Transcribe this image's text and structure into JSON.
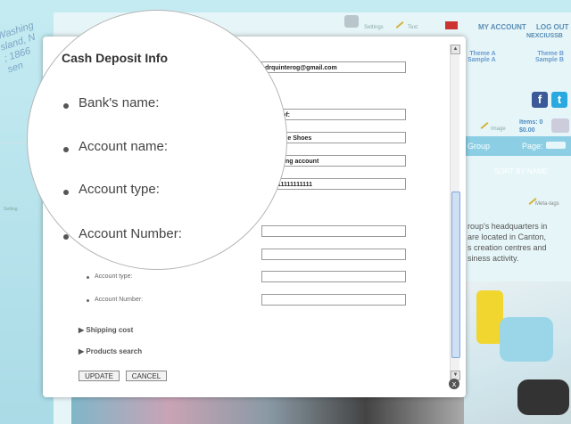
{
  "background": {
    "stamp_lines": [
      "Washing",
      "sland, N",
      "; 1866",
      "sen"
    ],
    "topbar": {
      "settings": "Settings",
      "text": "Text"
    },
    "links": {
      "my_account": "MY ACCOUNT",
      "log_out": "LOG OUT",
      "user": "NEXCIUSSB"
    },
    "themes": [
      {
        "line1": "Theme A",
        "line2": "Sample A"
      },
      {
        "line1": "Theme B",
        "line2": "Sample B"
      }
    ],
    "social": {
      "facebook": "f",
      "twitter": "t"
    },
    "image_label": "Image",
    "cart": {
      "items": "Items: 0",
      "total": "$0.00"
    },
    "group_bar": {
      "group": "Group",
      "page": "Page:"
    },
    "sort_label": "SORT BY NAME",
    "meta_tags": "Meta-tags",
    "side_setting": "Setting",
    "body_lines": [
      "roup's headquarters in",
      "are located in Canton,",
      "s creation centres and",
      "siness activity."
    ]
  },
  "modal": {
    "email": "drquinterog@gmail.com",
    "fields": [
      {
        "label": "Bank's name:",
        "value": "Bank of:"
      },
      {
        "label": "Account name:",
        "value": "New Age Shoes"
      },
      {
        "label": "Account type:",
        "value": "Checking account"
      },
      {
        "label": "Account Number:",
        "value": "111111111111111"
      }
    ],
    "extra_fields": [
      {
        "value": ""
      },
      {
        "value": ""
      },
      {
        "label": "Account type:",
        "value": ""
      },
      {
        "label": "Account Number:",
        "value": ""
      }
    ],
    "sections": [
      "Shipping cost",
      "Products search"
    ],
    "buttons": {
      "update": "UPDATE",
      "cancel": "CANCEL"
    },
    "close": "x"
  },
  "lens": {
    "title": "Cash Deposit Info",
    "labels": [
      "Bank's name:",
      "Account name:",
      "Account type:",
      "Account Number:"
    ]
  }
}
